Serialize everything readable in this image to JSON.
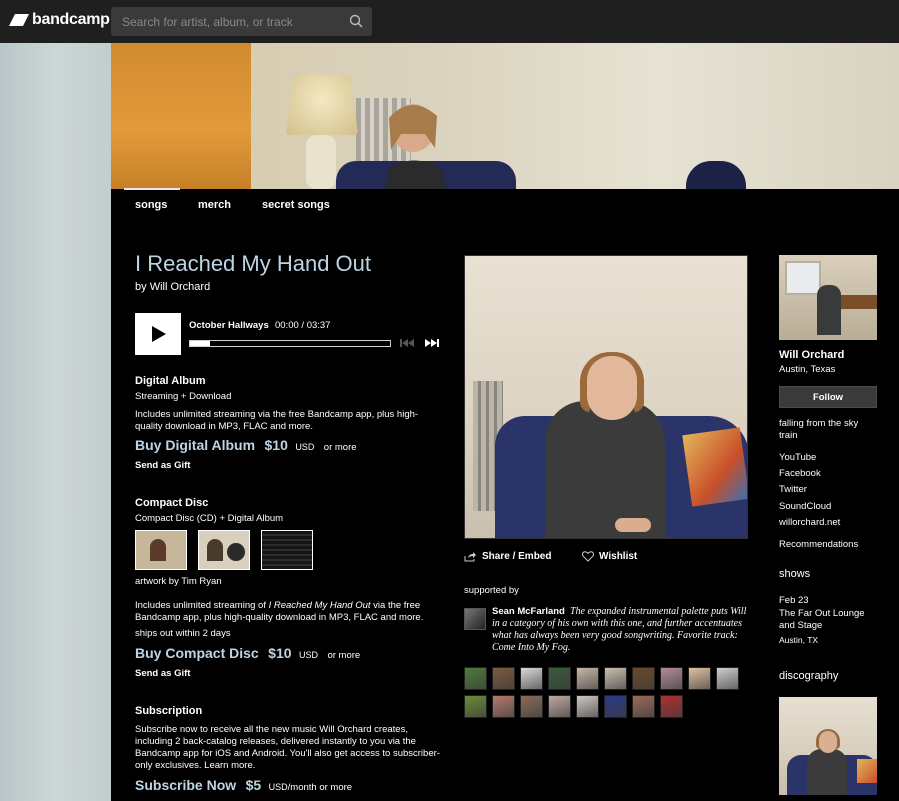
{
  "header": {
    "logo_text": "bandcamp",
    "search_placeholder": "Search for artist, album, or track"
  },
  "tabs": [
    "songs",
    "merch",
    "secret songs"
  ],
  "album": {
    "title": "I Reached My Hand Out",
    "by_prefix": "by",
    "artist": "Will Orchard"
  },
  "player": {
    "track_title": "October Hallways",
    "time": "00:00 / 03:37",
    "progress": 0.1
  },
  "digital": {
    "heading": "Digital Album",
    "subheading": "Streaming + Download",
    "description": "Includes unlimited streaming via the free Bandcamp app, plus high-quality download in MP3, FLAC and more.",
    "buy_label": "Buy Digital Album",
    "price": "$10",
    "currency": "USD",
    "or_more": "or more",
    "gift": "Send as Gift"
  },
  "cd": {
    "heading": "Compact Disc",
    "subheading": "Compact Disc (CD) + Digital Album",
    "artwork_credit": "artwork by Tim Ryan",
    "desc_before": "Includes unlimited streaming of ",
    "desc_title": "I Reached My Hand Out",
    "desc_after": " via the free Bandcamp app, plus high-quality download in MP3, FLAC and more.",
    "ships": "ships out within 2 days",
    "buy_label": "Buy Compact Disc",
    "price": "$10",
    "currency": "USD",
    "or_more": "or more",
    "gift": "Send as Gift"
  },
  "subscription": {
    "heading": "Subscription",
    "description": "Subscribe now to receive all the new music Will Orchard creates, including 2 back-catalog releases, delivered instantly to you via the Bandcamp app for iOS and Android. You'll also get access to subscriber-only exclusives.",
    "learn_more": "Learn more.",
    "buy_label": "Subscribe Now",
    "price": "$5",
    "currency": "USD",
    "per": "/month or more"
  },
  "actions": {
    "share": "Share / Embed",
    "wishlist": "Wishlist"
  },
  "supported": {
    "label": "supported by",
    "name": "Sean McFarland",
    "quote": "The expanded instrumental palette puts Will in a category of his own with this one, and further accentuates what has always been very good songwriting. Favorite track: Come Into My Fog."
  },
  "fans": [
    "#4f7a3a",
    "#7a5a3e",
    "#d8d8d8",
    "#3b5a3a",
    "#c9b6a6",
    "#c8c0b0",
    "#6b4a2a",
    "#b38a9a",
    "#e0c0a0",
    "#cfcfcf",
    "#6a8a3a",
    "#b57a6a",
    "#8a6a5a",
    "#c0a8a0",
    "#d0c8c0",
    "#2a3a8a",
    "#9a6a5a",
    "#b03030"
  ],
  "artist_sidebar": {
    "name": "Will Orchard",
    "location": "Austin, Texas",
    "follow": "Follow",
    "bio": "falling from the sky train",
    "links": [
      "YouTube",
      "Facebook",
      "Twitter",
      "SoundCloud",
      "willorchard.net"
    ],
    "recommendations": "Recommendations",
    "shows_heading": "shows",
    "show_date": "Feb 23",
    "show_venue": "The Far Out Lounge and Stage",
    "show_city": "Austin, TX",
    "discography_heading": "discography"
  }
}
